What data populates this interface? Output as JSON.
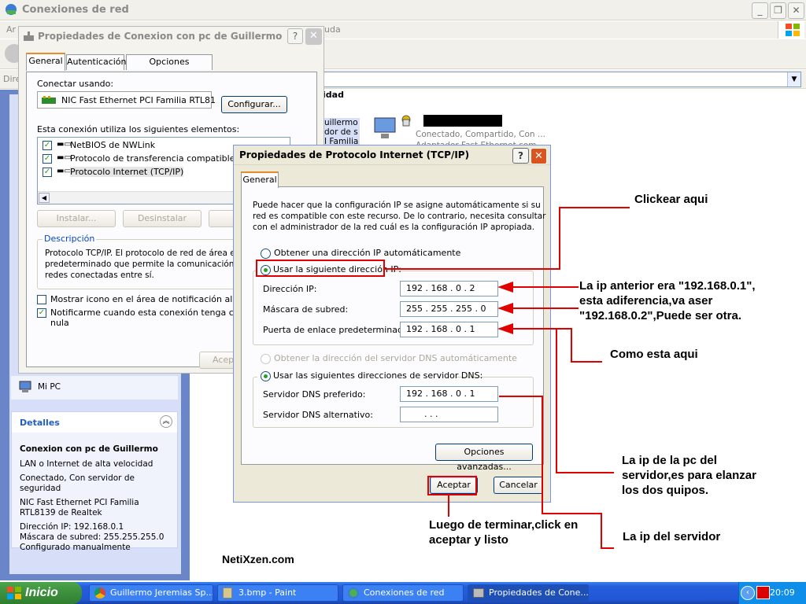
{
  "background_window": {
    "title": "Conexiones de red",
    "menu_fragments": [
      "Ar",
      "uda"
    ],
    "address_label_fragment": "Dire",
    "lan_section_label": "idad",
    "lan_fragment_lines": [
      "uillermo",
      "dor de s",
      "I Familia"
    ],
    "lan_status_lines": [
      "Conectado, Compartido, Con ...",
      "Adaptador Fast Ethernet com"
    ],
    "mi_pc": "Mi PC",
    "details": {
      "header": "Detalles",
      "name": "Conexion con pc de Guillermo",
      "lines": [
        "LAN o Internet de alta velocidad",
        "",
        "Conectado, Con servidor de seguridad",
        "",
        "NIC Fast Ethernet PCI Familia",
        "RTL8139 de Realtek",
        "",
        "Dirección IP: 192.168.0.1",
        "Máscara de subred: 255.255.255.0",
        "Configurado manualmente"
      ]
    }
  },
  "connection_dialog": {
    "title": "Propiedades de Conexion con pc de Guillermo",
    "tabs": [
      "General",
      "Autenticación",
      "Opciones avanzadas"
    ],
    "connect_using_label": "Conectar usando:",
    "adapter_name": "NIC Fast Ethernet PCI Familia RTL81",
    "configure_button": "Configurar...",
    "elements_label": "Esta conexión utiliza los siguientes elementos:",
    "elements": [
      "NetBIOS de NWLink",
      "Protocolo de transferencia compatible con N",
      "Protocolo Internet (TCP/IP)"
    ],
    "install_button": "Instalar...",
    "uninstall_button": "Desinstalar",
    "properties_button_fragment": "Pr",
    "description_label": "Descripción",
    "description_text": [
      "Protocolo TCP/IP. El protocolo de red de área exte",
      "predeterminado que permite la comunicación entre",
      "redes conectadas entre sí."
    ],
    "show_icon_label": "Mostrar icono en el área de notificación al conect",
    "notify_label_lines": [
      "Notificarme cuando esta conexión tenga conectiv",
      "nula"
    ],
    "accept_fragment": "Acep"
  },
  "tcpip_dialog": {
    "title": "Propiedades de Protocolo Internet (TCP/IP)",
    "tab": "General",
    "intro_lines": [
      "Puede hacer que la configuración IP se asigne automáticamente si su",
      "red es compatible con este recurso. De lo contrario, necesita consultar",
      "con el administrador de la red cuál es la configuración IP apropiada."
    ],
    "auto_ip_label": "Obtener una dirección IP automáticamente",
    "manual_ip_label": "Usar la siguiente dirección IP:",
    "ip_label": "Dirección IP:",
    "ip_value": "192 . 168 . 0 . 2",
    "mask_label": "Máscara de subred:",
    "mask_value": "255 . 255 . 255 . 0",
    "gateway_label": "Puerta de enlace predeterminada:",
    "gateway_value": "192 . 168 . 0 . 1",
    "auto_dns_label": "Obtener la dirección del servidor DNS automáticamente",
    "manual_dns_label": "Usar las siguientes direcciones de servidor DNS:",
    "dns_pref_label": "Servidor DNS preferido:",
    "dns_pref_value": "192 . 168 . 0 . 1",
    "dns_alt_label": "Servidor DNS alternativo:",
    "dns_alt_value": ".      .      .",
    "advanced_button": "Opciones avanzadas...",
    "ok_button": "Aceptar",
    "cancel_button": "Cancelar"
  },
  "annotations": {
    "click_here": "Clickear aqui",
    "previous_ip": [
      "La ip anterior era \"192.168.0.1\",",
      "esta adiferencia,va aser",
      "\"192.168.0.2\",Puede ser otra."
    ],
    "same_here": "Como esta aqui",
    "server_ip": [
      "La ip de la pc del",
      "servidor,es para elanzar",
      "los dos quipos."
    ],
    "finish": [
      "Luego de terminar,click en",
      "aceptar y listo"
    ],
    "server": "La ip del servidor",
    "watermark": "NetiXzen.com"
  },
  "taskbar": {
    "start": "Inicio",
    "tasks": [
      "Guillermo Jeremias Sp...",
      "3.bmp - Paint",
      "Conexiones de red",
      "Propiedades de Cone..."
    ],
    "clock": "20:09"
  },
  "colors": {
    "annotation_red": "#e00000",
    "xp_blue": "#245edb",
    "dialog_face": "#ece9d8"
  }
}
